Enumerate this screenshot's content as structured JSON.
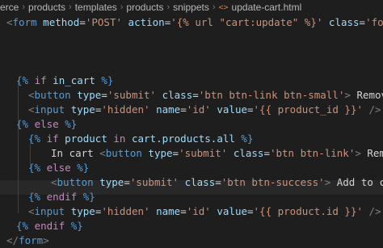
{
  "breadcrumb": {
    "items": [
      "erce",
      "products",
      "templates",
      "products",
      "snippets"
    ],
    "file_icon": "<>",
    "file_name": "update-cart.html"
  },
  "code": {
    "line1": {
      "p1": "<",
      "tag": "form",
      "a1": " method",
      "eq1": "=",
      "s1": "'POST'",
      "a2": " action",
      "eq2": "=",
      "s2": "'{% url \"cart:update\" %}'",
      "a3": " class",
      "eq3": "=",
      "s3": "'form-in"
    },
    "line5": {
      "open": "{%",
      "kw": " if ",
      "var": "in_cart",
      "close": " %}"
    },
    "line6": {
      "p1": "<",
      "tag": "button",
      "a1": " type",
      "eq1": "=",
      "s1": "'submit'",
      "a2": " class",
      "eq2": "=",
      "s2": "'btn btn-link btn-small'",
      "p2": ">",
      "txt": " Remove? ",
      "p3": "</"
    },
    "line7": {
      "p1": "<",
      "tag": "input",
      "a1": " type",
      "eq1": "=",
      "s1": "'hidden'",
      "a2": " name",
      "eq2": "=",
      "s2": "'id'",
      "a3": " value",
      "eq3": "=",
      "s3": "'{{ product_id }}'",
      "p2": " />"
    },
    "line8": {
      "open": "{%",
      "kw": " else ",
      "close": "%}"
    },
    "line9": {
      "open": "{%",
      "kw": " if ",
      "var": "product ",
      "kw2": "in ",
      "var2": "cart.products.all",
      "close": " %}"
    },
    "line10": {
      "txt": "In cart ",
      "p1": "<",
      "tag": "button",
      "a1": " type",
      "eq1": "=",
      "s1": "'submit'",
      "a2": " class",
      "eq2": "=",
      "s2": "'btn btn-link'",
      "p2": ">",
      "txt2": " Remove?"
    },
    "line11": {
      "open": "{%",
      "kw": " else ",
      "close": "%}"
    },
    "line12": {
      "p1": "<",
      "tag": "button",
      "a1": " type",
      "eq1": "=",
      "s1": "'submit'",
      "a2": " class",
      "eq2": "=",
      "s2": "'btn btn-success'",
      "p2": ">",
      "txt": " Add to cart"
    },
    "line13": {
      "open": "{%",
      "kw": " endif ",
      "close": "%}"
    },
    "line14": {
      "p1": "<",
      "tag": "input",
      "a1": " type",
      "eq1": "=",
      "s1": "'hidden'",
      "a2": " name",
      "eq2": "=",
      "s2": "'id'",
      "a3": " value",
      "eq3": "=",
      "s3": "'{{ product.id }}'",
      "p2": " /",
      "p3": ">"
    },
    "line15": {
      "open": "{%",
      "kw": " endif ",
      "close": "%}"
    },
    "line18": {
      "p1": "</",
      "tag": "form",
      "p2": ">"
    }
  }
}
